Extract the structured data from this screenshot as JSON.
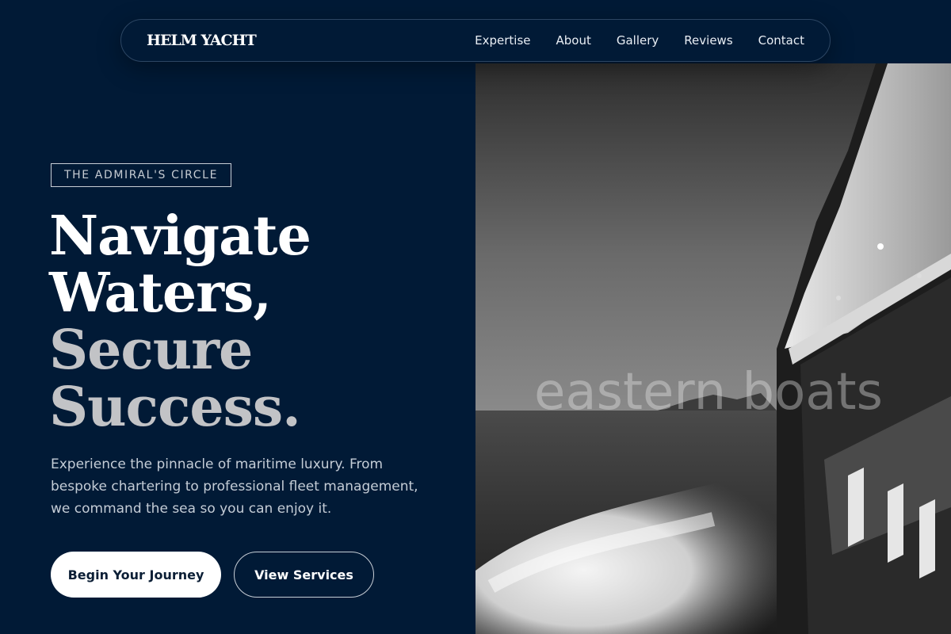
{
  "nav": {
    "logo": "HELM YACHT",
    "links": [
      "Expertise",
      "About",
      "Gallery",
      "Reviews",
      "Contact"
    ]
  },
  "hero": {
    "badge": "THE ADMIRAL'S CIRCLE",
    "headline": [
      "Navigate",
      "Waters,",
      "Secure",
      "Success."
    ],
    "description": "Experience the pinnacle of maritime luxury. From bespoke chartering to professional fleet management, we command the sea so you can enjoy it.",
    "primary_button": "Begin Your Journey",
    "secondary_button": "View Services",
    "image_watermark": "eastern boats"
  },
  "colors": {
    "background": "#011a36",
    "headline_white": "#ffffff",
    "headline_gray": "#c2c3c6",
    "button_primary_bg": "#ffffff"
  }
}
